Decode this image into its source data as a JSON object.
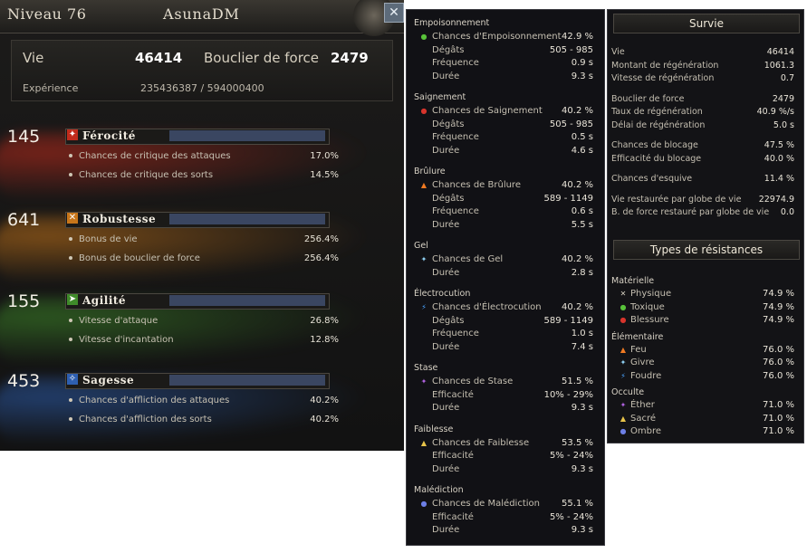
{
  "header": {
    "level": "Niveau 76",
    "name": "AsunaDM",
    "close_glyph": "✕"
  },
  "vitals": {
    "life_label": "Vie",
    "life_value": "46414",
    "shield_label": "Bouclier de force",
    "shield_value": "2479",
    "exp_label": "Expérience",
    "exp_value": "235436387  /  594000400"
  },
  "stats": [
    {
      "value": "145",
      "title": "Férocité",
      "icon": "ferocity-icon",
      "color": "#c02b1c",
      "lines": [
        {
          "label": "Chances de critique des attaques",
          "value": "17.0%"
        },
        {
          "label": "Chances de critique des sorts",
          "value": "14.5%"
        }
      ]
    },
    {
      "value": "641",
      "title": "Robustesse",
      "icon": "robustness-icon",
      "color": "#c8761a",
      "lines": [
        {
          "label": "Bonus de vie",
          "value": "256.4%"
        },
        {
          "label": "Bonus de bouclier de force",
          "value": "256.4%"
        }
      ]
    },
    {
      "value": "155",
      "title": "Agilité",
      "icon": "agility-icon",
      "color": "#3f8a2a",
      "lines": [
        {
          "label": "Vitesse d'attaque",
          "value": "26.8%"
        },
        {
          "label": "Vitesse d'incantation",
          "value": "12.8%"
        }
      ]
    },
    {
      "value": "453",
      "title": "Sagesse",
      "icon": "wisdom-icon",
      "color": "#2e5fb0",
      "lines": [
        {
          "label": "Chances d'affliction des attaques",
          "value": "40.2%"
        },
        {
          "label": "Chances d'affliction des sorts",
          "value": "40.2%"
        }
      ]
    }
  ],
  "afflictions": [
    {
      "name": "Empoisonnement",
      "icon": "poison-icon",
      "icon_color": "#58c23a",
      "rows": [
        {
          "label": "Chances d'Empoisonnement",
          "value": "42.9 %"
        },
        {
          "label": "Dégâts",
          "value": "505 - 985"
        },
        {
          "label": "Fréquence",
          "value": "0.9 s"
        },
        {
          "label": "Durée",
          "value": "9.3 s"
        }
      ]
    },
    {
      "name": "Saignement",
      "icon": "bleed-icon",
      "icon_color": "#d7342c",
      "rows": [
        {
          "label": "Chances de Saignement",
          "value": "40.2 %"
        },
        {
          "label": "Dégâts",
          "value": "505 - 985"
        },
        {
          "label": "Fréquence",
          "value": "0.5 s"
        },
        {
          "label": "Durée",
          "value": "4.6 s"
        }
      ]
    },
    {
      "name": "Brûlure",
      "icon": "burn-icon",
      "icon_color": "#f07a22",
      "rows": [
        {
          "label": "Chances de Brûlure",
          "value": "40.2 %"
        },
        {
          "label": "Dégâts",
          "value": "589 - 1149"
        },
        {
          "label": "Fréquence",
          "value": "0.6 s"
        },
        {
          "label": "Durée",
          "value": "5.5 s"
        }
      ]
    },
    {
      "name": "Gel",
      "icon": "frost-icon",
      "icon_color": "#8fd0f2",
      "rows": [
        {
          "label": "Chances de Gel",
          "value": "40.2 %"
        },
        {
          "label": "Durée",
          "value": "2.8 s"
        }
      ]
    },
    {
      "name": "Électrocution",
      "icon": "shock-icon",
      "icon_color": "#4aa3ff",
      "rows": [
        {
          "label": "Chances d'Électrocution",
          "value": "40.2 %"
        },
        {
          "label": "Dégâts",
          "value": "589 - 1149"
        },
        {
          "label": "Fréquence",
          "value": "1.0 s"
        },
        {
          "label": "Durée",
          "value": "7.4 s"
        }
      ]
    },
    {
      "name": "Stase",
      "icon": "stasis-icon",
      "icon_color": "#b062e0",
      "rows": [
        {
          "label": "Chances de Stase",
          "value": "51.5 %"
        },
        {
          "label": "Efficacité",
          "value": "10% - 29%"
        },
        {
          "label": "Durée",
          "value": "9.3 s"
        }
      ]
    },
    {
      "name": "Faiblesse",
      "icon": "weakness-icon",
      "icon_color": "#e8c44a",
      "rows": [
        {
          "label": "Chances de Faiblesse",
          "value": "53.5 %"
        },
        {
          "label": "Efficacité",
          "value": "5% - 24%"
        },
        {
          "label": "Durée",
          "value": "9.3 s"
        }
      ]
    },
    {
      "name": "Malédiction",
      "icon": "curse-icon",
      "icon_color": "#6d7fe6",
      "rows": [
        {
          "label": "Chances de Malédiction",
          "value": "55.1 %"
        },
        {
          "label": "Efficacité",
          "value": "5% - 24%"
        },
        {
          "label": "Durée",
          "value": "9.3 s"
        }
      ]
    }
  ],
  "survival": {
    "title": "Survie",
    "groups": [
      [
        {
          "label": "Vie",
          "value": "46414"
        },
        {
          "label": "Montant de régénération",
          "value": "1061.3"
        },
        {
          "label": "Vitesse de régénération",
          "value": "0.7"
        }
      ],
      [
        {
          "label": "Bouclier de force",
          "value": "2479"
        },
        {
          "label": "Taux de régénération",
          "value": "40.9 %/s"
        },
        {
          "label": "Délai de régénération",
          "value": "5.0 s"
        }
      ],
      [
        {
          "label": "Chances de blocage",
          "value": "47.5 %"
        },
        {
          "label": "Efficacité du blocage",
          "value": "40.0 %"
        }
      ],
      [
        {
          "label": "Chances d'esquive",
          "value": "11.4 %"
        }
      ],
      [
        {
          "label": "Vie restaurée par globe de vie",
          "value": "22974.9"
        },
        {
          "label": "B. de force restauré par globe de vie",
          "value": "0.0"
        }
      ]
    ]
  },
  "resistances": {
    "title": "Types de résistances",
    "groups": [
      {
        "name": "Matérielle",
        "items": [
          {
            "label": "Physique",
            "value": "74.9 %",
            "icon": "physical-icon",
            "icon_color": "#d9d3c4"
          },
          {
            "label": "Toxique",
            "value": "74.9 %",
            "icon": "toxic-icon",
            "icon_color": "#58c23a"
          },
          {
            "label": "Blessure",
            "value": "74.9 %",
            "icon": "wound-icon",
            "icon_color": "#d7342c"
          }
        ]
      },
      {
        "name": "Élémentaire",
        "items": [
          {
            "label": "Feu",
            "value": "76.0 %",
            "icon": "fire-icon",
            "icon_color": "#f07a22"
          },
          {
            "label": "Givre",
            "value": "76.0 %",
            "icon": "frost-icon",
            "icon_color": "#8fd0f2"
          },
          {
            "label": "Foudre",
            "value": "76.0 %",
            "icon": "lightning-icon",
            "icon_color": "#4aa3ff"
          }
        ]
      },
      {
        "name": "Occulte",
        "items": [
          {
            "label": "Éther",
            "value": "71.0 %",
            "icon": "ether-icon",
            "icon_color": "#b062e0"
          },
          {
            "label": "Sacré",
            "value": "71.0 %",
            "icon": "holy-icon",
            "icon_color": "#e8c44a"
          },
          {
            "label": "Ombre",
            "value": "71.0 %",
            "icon": "shadow-icon",
            "icon_color": "#6d7fe6"
          }
        ]
      }
    ]
  }
}
